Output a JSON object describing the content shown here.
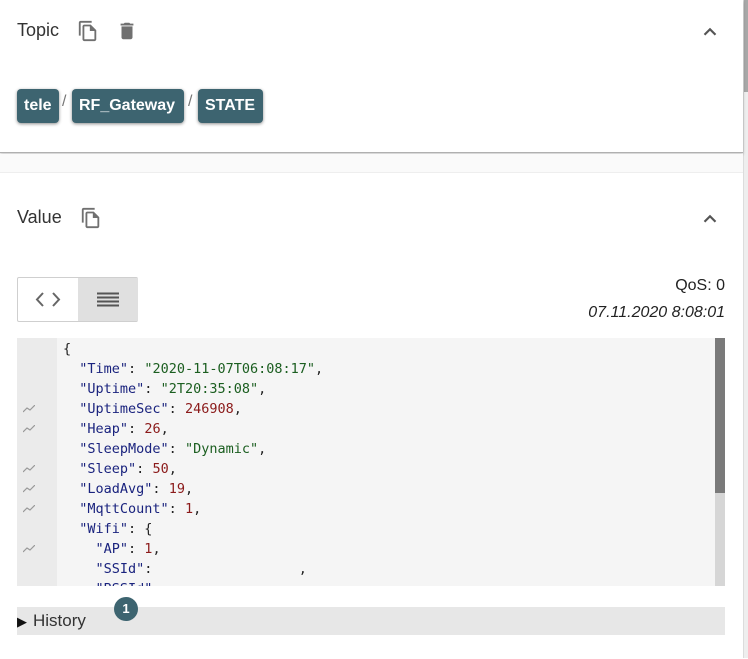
{
  "topic": {
    "title": "Topic",
    "segments": [
      "tele",
      "RF_Gateway",
      "STATE"
    ],
    "separator": "/"
  },
  "value": {
    "title": "Value",
    "qos": "QoS: 0",
    "timestamp": "07.11.2020 8:08:01",
    "code_lines": [
      [
        [
          "p",
          "{"
        ]
      ],
      [
        [
          "p",
          "  "
        ],
        [
          "k",
          "\"Time\""
        ],
        [
          "p",
          ": "
        ],
        [
          "s",
          "\"2020-11-07T06:08:17\""
        ],
        [
          "p",
          ","
        ]
      ],
      [
        [
          "p",
          "  "
        ],
        [
          "k",
          "\"Uptime\""
        ],
        [
          "p",
          ": "
        ],
        [
          "s",
          "\"2T20:35:08\""
        ],
        [
          "p",
          ","
        ]
      ],
      [
        [
          "p",
          "  "
        ],
        [
          "k",
          "\"UptimeSec\""
        ],
        [
          "p",
          ": "
        ],
        [
          "n",
          "246908"
        ],
        [
          "p",
          ","
        ]
      ],
      [
        [
          "p",
          "  "
        ],
        [
          "k",
          "\"Heap\""
        ],
        [
          "p",
          ": "
        ],
        [
          "n",
          "26"
        ],
        [
          "p",
          ","
        ]
      ],
      [
        [
          "p",
          "  "
        ],
        [
          "k",
          "\"SleepMode\""
        ],
        [
          "p",
          ": "
        ],
        [
          "s",
          "\"Dynamic\""
        ],
        [
          "p",
          ","
        ]
      ],
      [
        [
          "p",
          "  "
        ],
        [
          "k",
          "\"Sleep\""
        ],
        [
          "p",
          ": "
        ],
        [
          "n",
          "50"
        ],
        [
          "p",
          ","
        ]
      ],
      [
        [
          "p",
          "  "
        ],
        [
          "k",
          "\"LoadAvg\""
        ],
        [
          "p",
          ": "
        ],
        [
          "n",
          "19"
        ],
        [
          "p",
          ","
        ]
      ],
      [
        [
          "p",
          "  "
        ],
        [
          "k",
          "\"MqttCount\""
        ],
        [
          "p",
          ": "
        ],
        [
          "n",
          "1"
        ],
        [
          "p",
          ","
        ]
      ],
      [
        [
          "p",
          "  "
        ],
        [
          "k",
          "\"Wifi\""
        ],
        [
          "p",
          ": {"
        ]
      ],
      [
        [
          "p",
          "    "
        ],
        [
          "k",
          "\"AP\""
        ],
        [
          "p",
          ": "
        ],
        [
          "n",
          "1"
        ],
        [
          "p",
          ","
        ]
      ],
      [
        [
          "p",
          "    "
        ],
        [
          "k",
          "\"SSId\""
        ],
        [
          "p",
          ":                  ,"
        ]
      ],
      [
        [
          "p",
          "    "
        ],
        [
          "k",
          "\"BSSId\""
        ],
        [
          "p",
          ":"
        ]
      ]
    ],
    "chart_marks": [
      3,
      4,
      6,
      7,
      8,
      10
    ]
  },
  "history": {
    "label": "History",
    "count": "1"
  }
}
